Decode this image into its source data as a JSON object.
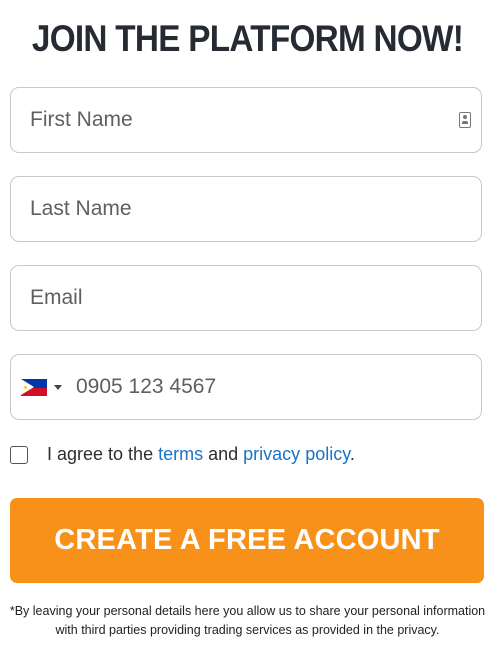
{
  "header": {
    "title": "JOIN THE PLATFORM NOW!"
  },
  "form": {
    "first_name": {
      "placeholder": "First Name",
      "value": ""
    },
    "last_name": {
      "placeholder": "Last Name",
      "value": ""
    },
    "email": {
      "placeholder": "Email",
      "value": ""
    },
    "phone": {
      "placeholder": "0905 123 4567",
      "value": "",
      "country_flag": "philippines-flag-icon"
    },
    "consent": {
      "prefix": "I agree to the",
      "terms_link": "terms",
      "conjunction": "and",
      "privacy_link": "privacy policy",
      "suffix": ".",
      "checked": false
    },
    "submit_label": "CREATE A FREE ACCOUNT"
  },
  "disclaimer": {
    "line1": "*By leaving your personal details here you allow us to share your personal information",
    "line2": "with third parties providing trading services as provided in the privacy."
  },
  "colors": {
    "accent": "#f7911a",
    "link": "#1a73c9",
    "title": "#252a33"
  }
}
